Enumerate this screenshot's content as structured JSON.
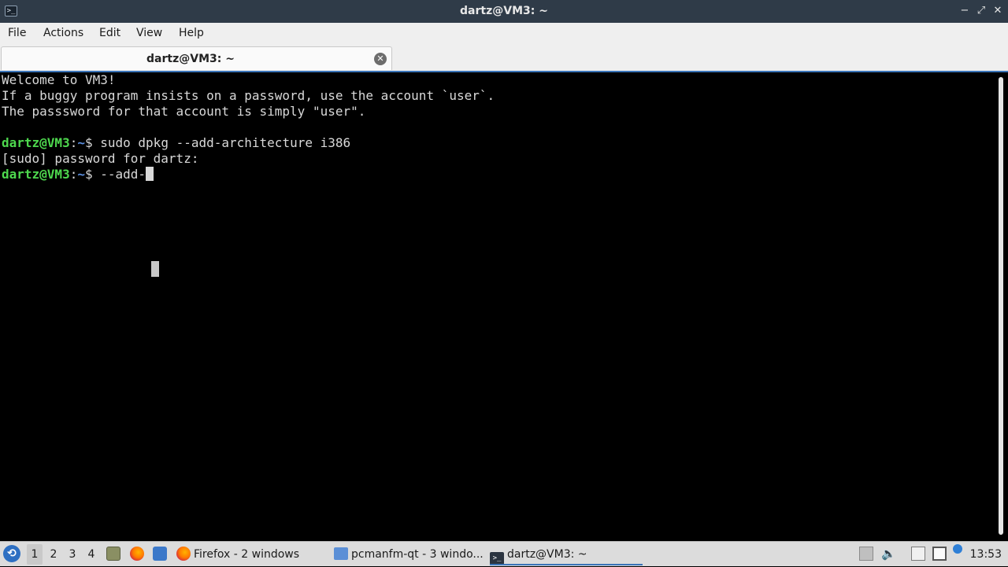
{
  "window": {
    "title": "dartz@VM3: ~",
    "controls": {
      "minimize": "−",
      "maximize": "⤢",
      "close": "✕"
    }
  },
  "menubar": {
    "items": [
      "File",
      "Actions",
      "Edit",
      "View",
      "Help"
    ]
  },
  "tab": {
    "label": "dartz@VM3: ~",
    "close_icon": "close-circle-icon"
  },
  "terminal": {
    "lines": [
      "Welcome to VM3!",
      "If a buggy program insists on a password, use the account `user`.",
      "The passsword for that account is simply \"user\"."
    ],
    "prompt_user": "dartz@VM3",
    "prompt_sep": ":",
    "prompt_path": "~",
    "prompt_symbol": "$ ",
    "command1": "sudo dpkg --add-architecture i386",
    "sudo_line": "[sudo] password for dartz:",
    "command2": "--add-"
  },
  "taskbar": {
    "desktops": [
      "1",
      "2",
      "3",
      "4"
    ],
    "active_desktop": "1",
    "quicklaunch": [
      "file-manager-icon",
      "firefox-icon",
      "desktop-icon"
    ],
    "tasks": [
      {
        "label": "Firefox - 2 windows",
        "icon": "firefox-icon"
      },
      {
        "label": "pcmanfm-qt - 3 windo...",
        "icon": "folder-icon"
      },
      {
        "label": "dartz@VM3: ~",
        "icon": "terminal-icon"
      }
    ],
    "tray": [
      "upload-icon",
      "volume-icon",
      "clipboard-icon",
      "screenshot-icon",
      "update-icon"
    ],
    "clock": "13:53"
  },
  "colors": {
    "titlebar": "#2f3b48",
    "prompt_user": "#4ed84e",
    "prompt_path": "#5b8fe0",
    "accent": "#3a74b8"
  }
}
